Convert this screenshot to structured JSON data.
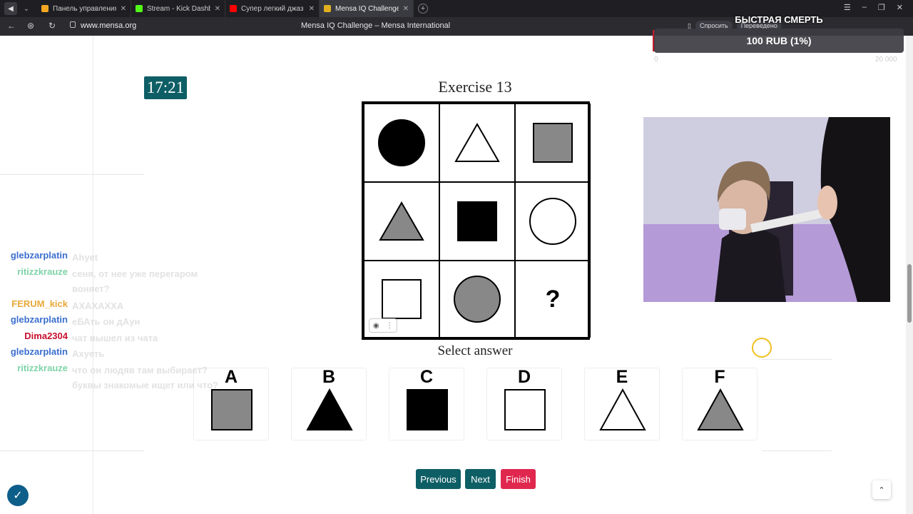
{
  "browser": {
    "tabs": [
      {
        "title": "Панель управления - Do",
        "color": "#f5a623",
        "active": false
      },
      {
        "title": "Stream - Kick Dashb",
        "color": "#53fc18",
        "active": false
      },
      {
        "title": "Супер легкий джаз",
        "color": "#ff0000",
        "active": false
      },
      {
        "title": "Mensa IQ Challenge – M",
        "color": "#e0b020",
        "active": true
      }
    ],
    "url": "www.mensa.org",
    "page_title": "Mensa IQ Challenge – Mensa International",
    "ask_label": "Спросить",
    "translated_label": "Переведено"
  },
  "overlay": {
    "donation_title": "БЫСТРАЯ СМЕРТЬ",
    "donation_amount": "100 RUB (1%)",
    "scale_min": "0",
    "scale_max": "20 000"
  },
  "quiz": {
    "timer": "17:21",
    "exercise_title": "Exercise 13",
    "question_mark": "?",
    "select_answer": "Select answer",
    "grid": [
      {
        "shape": "circle",
        "fill": "#000000"
      },
      {
        "shape": "triangle",
        "fill": "#ffffff"
      },
      {
        "shape": "square",
        "fill": "#888888"
      },
      {
        "shape": "triangle",
        "fill": "#888888"
      },
      {
        "shape": "square",
        "fill": "#000000"
      },
      {
        "shape": "circle",
        "fill": "#ffffff"
      },
      {
        "shape": "square",
        "fill": "#ffffff"
      },
      {
        "shape": "circle",
        "fill": "#888888"
      },
      {
        "shape": "question",
        "fill": ""
      }
    ],
    "options": [
      {
        "letter": "A",
        "shape": "square",
        "fill": "#888888"
      },
      {
        "letter": "B",
        "shape": "triangle",
        "fill": "#000000"
      },
      {
        "letter": "C",
        "shape": "square",
        "fill": "#000000"
      },
      {
        "letter": "D",
        "shape": "square",
        "fill": "#ffffff"
      },
      {
        "letter": "E",
        "shape": "triangle",
        "fill": "#ffffff"
      },
      {
        "letter": "F",
        "shape": "triangle",
        "fill": "#888888"
      }
    ],
    "buttons": {
      "previous": "Previous",
      "next": "Next",
      "finish": "Finish"
    }
  },
  "chat": [
    {
      "user": "glebzarplatin",
      "color": "#3b6fd0",
      "text": "Ahyet"
    },
    {
      "user": "ritizzkrauze",
      "color": "#7ed3a8",
      "text": "сеня, от нее уже перегаром воняет?"
    },
    {
      "user": "FERUM_kick",
      "color": "#e8a838",
      "text": "АХАХАХХА"
    },
    {
      "user": "glebzarplatin",
      "color": "#3b6fd0",
      "text": "еБАть он дАун"
    },
    {
      "user": "Dima2304",
      "color": "#c8102e",
      "text": "чат вышел из чата"
    },
    {
      "user": "glebzarplatin",
      "color": "#3b6fd0",
      "text": "Ахуеть"
    },
    {
      "user": "ritizzkrauze",
      "color": "#7ed3a8",
      "text": "что он людяв там выбирает? буквы знакомые ищет или что?"
    }
  ],
  "colors": {
    "accent": "#0e5e65",
    "finish": "#e0284f"
  }
}
